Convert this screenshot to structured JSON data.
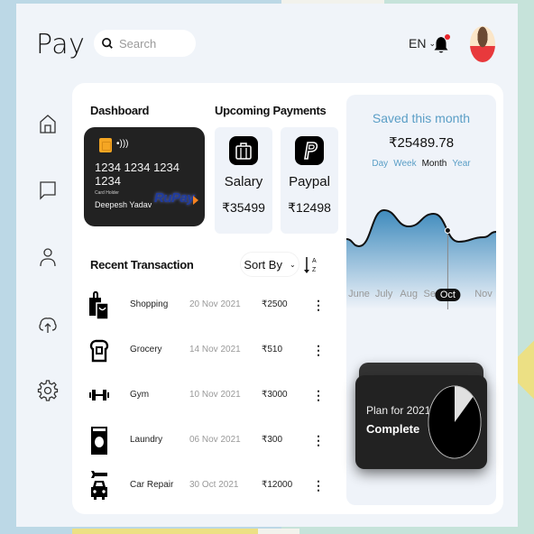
{
  "header": {
    "logo": "Pay",
    "search_placeholder": "Search",
    "language": "EN",
    "notification_badge": true
  },
  "sidebar": {
    "items": [
      {
        "name": "home",
        "icon": "home-icon"
      },
      {
        "name": "messages",
        "icon": "chat-icon"
      },
      {
        "name": "profile",
        "icon": "user-icon"
      },
      {
        "name": "upload",
        "icon": "cloud-upload-icon"
      },
      {
        "name": "settings",
        "icon": "gear-icon"
      }
    ]
  },
  "dashboard": {
    "title": "Dashboard",
    "card": {
      "number": "1234 1234 1234 1234",
      "holder_label": "Card Holder",
      "holder_name": "Deepesh Yadav",
      "network": "RuPay"
    }
  },
  "upcoming_payments": {
    "title": "Upcoming Payments",
    "items": [
      {
        "name": "Salary",
        "amount": "₹35499",
        "icon": "briefcase-icon"
      },
      {
        "name": "Paypal",
        "amount": "₹12498",
        "icon": "paypal-icon"
      }
    ]
  },
  "transactions": {
    "title": "Recent Transaction",
    "sort_label": "Sort By",
    "rows": [
      {
        "name": "Shopping",
        "date": "20 Nov 2021",
        "amount": "₹2500",
        "icon": "shopping-bag-icon"
      },
      {
        "name": "Grocery",
        "date": "14 Nov 2021",
        "amount": "₹510",
        "icon": "bread-icon"
      },
      {
        "name": "Gym",
        "date": "10 Nov 2021",
        "amount": "₹3000",
        "icon": "dumbbell-icon"
      },
      {
        "name": "Laundry",
        "date": "06 Nov 2021",
        "amount": "₹300",
        "icon": "washing-machine-icon"
      },
      {
        "name": "Car Repair",
        "date": "30 Oct 2021",
        "amount": "₹12000",
        "icon": "car-repair-icon"
      }
    ]
  },
  "savings": {
    "title": "Saved this month",
    "amount": "₹25489.78",
    "tabs": [
      {
        "label": "Day",
        "active": false
      },
      {
        "label": "Week",
        "active": false
      },
      {
        "label": "Month",
        "active": true
      },
      {
        "label": "Year",
        "active": false
      }
    ],
    "chart_data": {
      "type": "area",
      "categories": [
        "June",
        "July",
        "Aug",
        "Sept",
        "Oct",
        "Nov"
      ],
      "values": [
        40,
        80,
        62,
        76,
        45,
        50
      ],
      "selected": "Oct",
      "colors": {
        "line": "#111111",
        "fill_top": "#5a9ec6",
        "fill_bottom": "#eff3f9"
      }
    }
  },
  "plan": {
    "label": "Plan for 2021",
    "status": "Complete",
    "progress_fraction": 0.875
  }
}
